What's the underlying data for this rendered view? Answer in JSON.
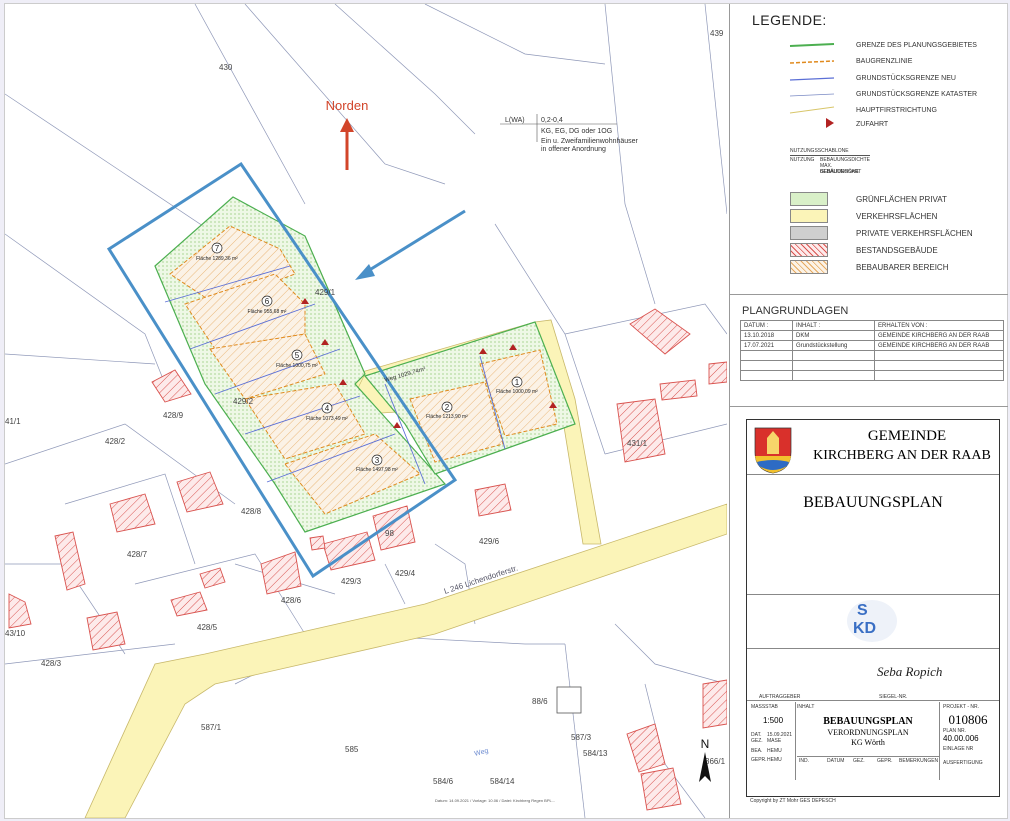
{
  "map": {
    "north_label": "Norden",
    "compass_label": "N",
    "nutzung": {
      "row1_label": "L(WA)",
      "row1_value": "0,2-0,4",
      "row2": "KG, EG, DG oder 1OG",
      "row3": "Ein u. Zweifamilienwohnhäuser",
      "row4": "in offener Anordnung"
    },
    "parcels": [
      "430",
      "429/1",
      "428/9",
      "428/2",
      "429/2",
      "428/8",
      "428/7",
      "428/6",
      "428/5",
      "428/3",
      "429/3",
      "429/4",
      "429/6",
      "431/1",
      "587/1",
      "585",
      "587/3",
      "584/13",
      "584/6",
      "584/14",
      "88/6",
      "98",
      "43/10",
      "439",
      "41/1",
      "366/1"
    ],
    "lots": [
      {
        "num": "1",
        "area": "Fläche 1000,09 m²"
      },
      {
        "num": "2",
        "area": "Fläche 1213,90 m²"
      },
      {
        "num": "3",
        "area": "Fläche 1497,98 m²"
      },
      {
        "num": "4",
        "area": "Fläche 1073,49 m²"
      },
      {
        "num": "5",
        "area": "Fläche 1000,75 m²"
      },
      {
        "num": "6",
        "area": "Fläche 955,68 m²"
      },
      {
        "num": "7",
        "area": "Fläche 1289,36 m²"
      }
    ],
    "weg_label": "Weg 1029,74m²",
    "road_label": "L 246 Lichendorferstr.",
    "weg2_label": "Weg",
    "bottom_note": "Datum: 14.09.2021 / Vorlage: 10.06 / Datei: Kirchberg Regen BPL..."
  },
  "legend": {
    "title": "LEGENDE:",
    "lines": [
      {
        "label": "GRENZE DES PLANUNGSGEBIETES",
        "color": "#4caf50"
      },
      {
        "label": "BAUGRENZLINIE",
        "color": "#e08a1e"
      },
      {
        "label": "GRUNDSTÜCKSGRENZE NEU",
        "color": "#5b6fd6"
      },
      {
        "label": "GRUNDSTÜCKSGRENZE KATASTER",
        "color": "#7a8ac4"
      },
      {
        "label": "HAUPTFIRSTRICHTUNG",
        "color": "#d8c66a"
      },
      {
        "label": "ZUFAHRT",
        "color": "#b22222"
      }
    ],
    "schablone_title": "NUTZUNGSSCHABLONE",
    "schablone_cells": [
      "NUTZUNG",
      "BEBAUUNGSDICHTE",
      "MAX. GEBÄUDEHÖHE",
      "BEBAUUNGSART"
    ],
    "areas": [
      {
        "label": "GRÜNFLÄCHEN PRIVAT",
        "color": "#d9f0c8"
      },
      {
        "label": "VERKEHRSFLÄCHEN",
        "color": "#fbf4b8"
      },
      {
        "label": "PRIVATE VERKEHRSFLÄCHEN",
        "color": "#cfcfcf"
      },
      {
        "label": "BESTANDSGEBÄUDE",
        "color": "#f6d3d3"
      },
      {
        "label": "BEBAUBARER BEREICH",
        "color": "#f7e6cf"
      }
    ]
  },
  "plangrundlagen": {
    "title": "PLANGRUNDLAGEN",
    "headers": [
      "DATUM :",
      "INHALT :",
      "ERHALTEN VON :"
    ],
    "rows": [
      [
        "13.10.2018",
        "DKM",
        "GEMEINDE  KIRCHBERG AN DER RAAB"
      ],
      [
        "17.07.2021",
        "Grundstückstellung",
        "GEMEINDE  KIRCHBERG AN DER RAAB"
      ]
    ]
  },
  "titleblock": {
    "gemeinde": "GEMEINDE",
    "ort": "KIRCHBERG AN DER RAAB",
    "plan_title": "BEBAUUNGSPLAN",
    "logo_top": "S",
    "logo_bottom": "KD",
    "auftraggeber": "AUFTRAGGEBER",
    "siegel": "SIEGEL-NR.",
    "signature": "Seba Ropich",
    "massstab_label": "MASSSTAB",
    "massstab": "1:500",
    "inhalt_label": "INHALT",
    "inhalt1": "BEBAUUNGSPLAN",
    "inhalt2": "VERORDNUNGSPLAN",
    "inhalt3": "KG Wörth",
    "projekt_label": "PROJEKT - NR.",
    "projekt": "010806",
    "plan_label": "PLAN NR.",
    "plan_nr": "40.00.006",
    "einlage": "EINLAGE NR",
    "datum_label": "DAT.",
    "datum": "15.09.2021",
    "gez": "GEZ.",
    "gez_val": "MASE",
    "bea": "BEA.",
    "bea_val": "HEMU",
    "gepr": "GEPR.",
    "gepr_val": "HEMU",
    "ausfertigung": "AUSFERTIGUNG",
    "rev_headers": [
      "IND.",
      "DATUM",
      "GEZ.",
      "GEPR.",
      "BEMERKUNGEN"
    ],
    "copyright": "Copyright by ZT Mohr GES DEPESCH"
  },
  "colors": {
    "blue_frame": "#4a90c8",
    "north_arrow": "#d2452a",
    "road": "#fbf4b8"
  }
}
